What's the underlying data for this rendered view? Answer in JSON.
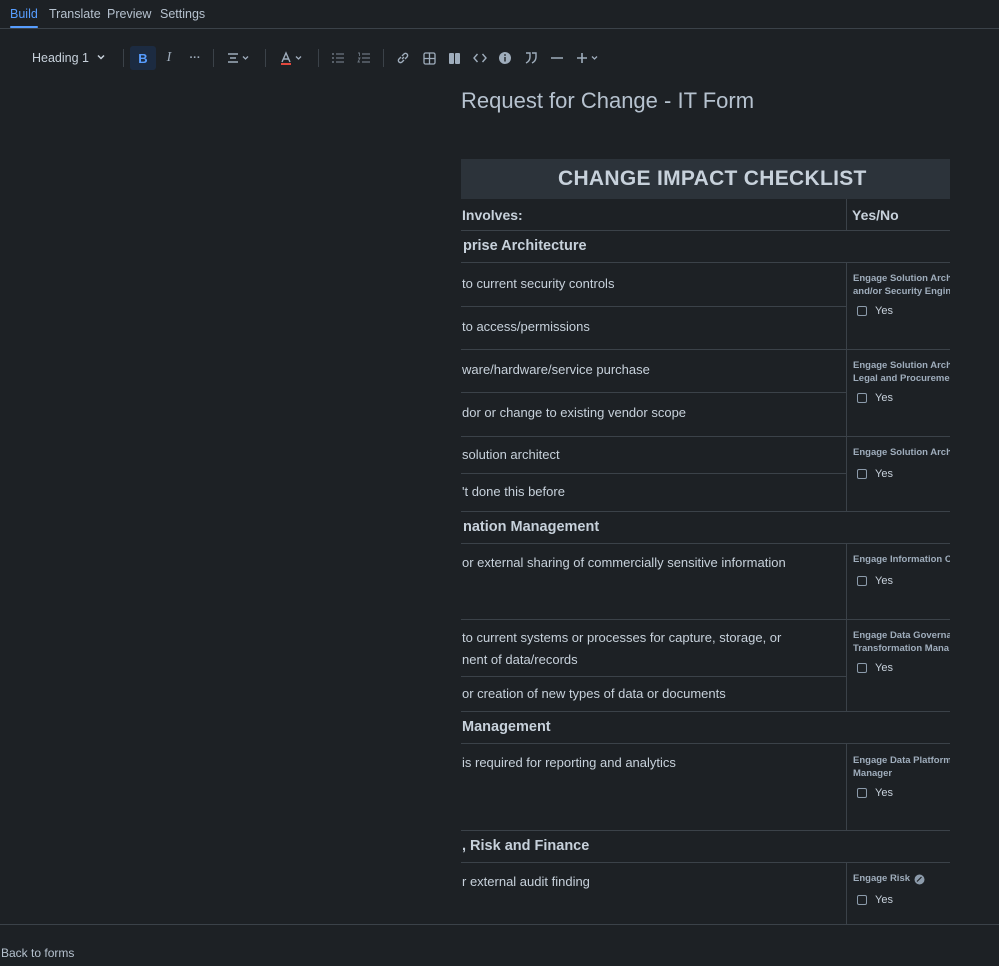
{
  "tabs": [
    {
      "label": "Build"
    },
    {
      "label": "Translate"
    },
    {
      "label": "Preview"
    },
    {
      "label": "Settings"
    }
  ],
  "toolbar": {
    "text_style": "Heading 1",
    "bold_label": "B",
    "italic_label": "I",
    "more_label": "···",
    "icons": [
      "align-icon",
      "text-color-icon",
      "bullet-list-icon",
      "numbered-list-icon",
      "link-icon",
      "table-icon",
      "layout-icon",
      "code-icon",
      "info-icon",
      "quote-icon",
      "divider-icon",
      "insert-icon"
    ]
  },
  "form": {
    "title": "Request for Change - IT Form",
    "checklist_title": "CHANGE IMPACT CHECKLIST",
    "col_involves": "Involves:",
    "col_yesno": "Yes/No",
    "sections": {
      "s1": "prise Architecture",
      "s2": "nation Management",
      "s3": "Management",
      "s4": ", Risk and Finance"
    },
    "items": {
      "i1": "to current security controls",
      "i2": "to access/permissions",
      "i3": "ware/hardware/service purchase",
      "i4": "dor or change to existing vendor scope",
      "i5": "solution architect",
      "i6": "'t done this before",
      "i7": " or external sharing of commercially sensitive information",
      "i8a": "to current systems or processes for capture, storage, or",
      "i8b": "nent of data/records",
      "i9": " or creation of new types of data or documents",
      "i10": " is required for reporting and analytics",
      "i11": "r external audit finding"
    },
    "engage": {
      "e1a": "Engage Solution Arch",
      "e1b": "and/or Security Engin",
      "e2a": "Engage Solution Arch",
      "e2b": "Legal and Procuremen",
      "e3a": "Engage Solution Arch",
      "e4a": "Engage Information C",
      "e5a": "Engage Data Governa",
      "e5b": "Transformation Mana",
      "e6a": "Engage Data Platform",
      "e6b": "Manager",
      "e7a": "Engage Risk"
    },
    "yes_label": "Yes"
  },
  "footer": {
    "back_label": "Back to forms"
  }
}
